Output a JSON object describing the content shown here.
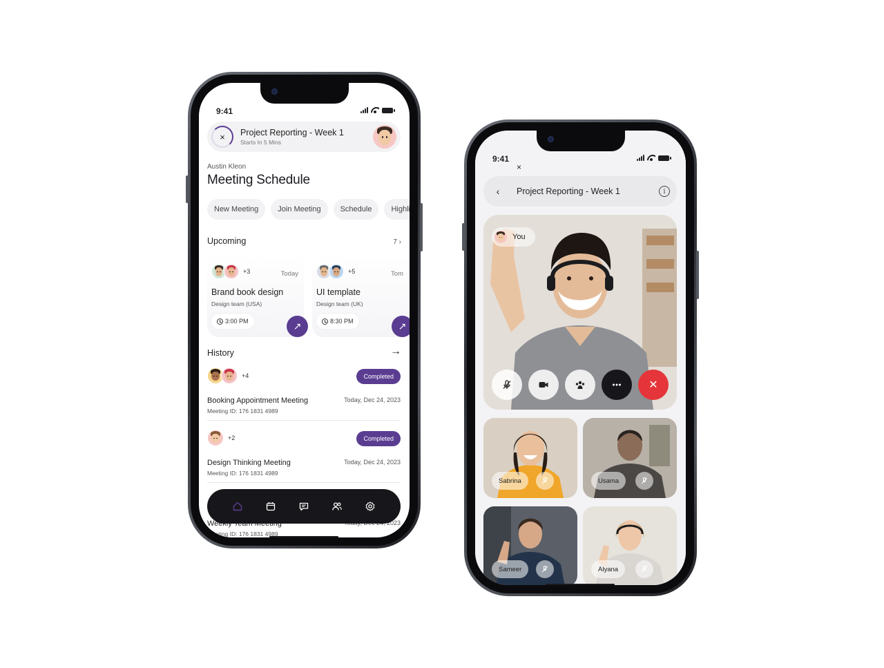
{
  "status": {
    "time": "9:41"
  },
  "schedule": {
    "banner": {
      "close": "×",
      "title": "Project Reporting - Week 1",
      "subtitle": "Starts In 5 Mins"
    },
    "owner": "Austin Kleon",
    "title": "Meeting Schedule",
    "chips": [
      "New Meeting",
      "Join Meeting",
      "Schedule",
      "Highlig"
    ],
    "upcoming": {
      "title": "Upcoming",
      "count": "7 ›",
      "cards": [
        {
          "extra": "+3",
          "when": "Today",
          "title": "Brand book design",
          "team": "Design team (USA)",
          "time": "3:00 PM"
        },
        {
          "extra": "+5",
          "when": "Tom",
          "title": "UI template",
          "team": "Design team (UK)",
          "time": "8:30 PM"
        }
      ]
    },
    "history": {
      "title": "History",
      "arrow": "→",
      "items": [
        {
          "extra": "+4",
          "status": "Completed",
          "title": "Booking Appointment Meeting",
          "id": "Meeting ID: 176 1831 4989",
          "date": "Today, Dec 24, 2023"
        },
        {
          "extra": "+2",
          "status": "Completed",
          "title": "Design Thinking Meeting",
          "id": "Meeting ID: 176 1831 4989",
          "date": "Today, Dec 24, 2023"
        },
        {
          "title": "Weekly Team Meeting",
          "id": "Meeting ID: 176 1831 4989",
          "date": "Today, Dec 24, 2023"
        }
      ]
    },
    "nav": [
      "home-icon",
      "calendar-icon",
      "chat-icon",
      "users-icon",
      "settings-icon"
    ]
  },
  "call": {
    "close": "×",
    "back": "‹",
    "title": "Project Reporting - Week 1",
    "info": "i",
    "self_label": "You",
    "end": "✕",
    "participants": [
      {
        "name": "Sabrina"
      },
      {
        "name": "Usama"
      },
      {
        "name": "Sameer"
      },
      {
        "name": "Alyana"
      }
    ]
  },
  "colors": {
    "accent": "#5a3d91",
    "end_call": "#e5353a",
    "nav_bg": "#17171b"
  }
}
